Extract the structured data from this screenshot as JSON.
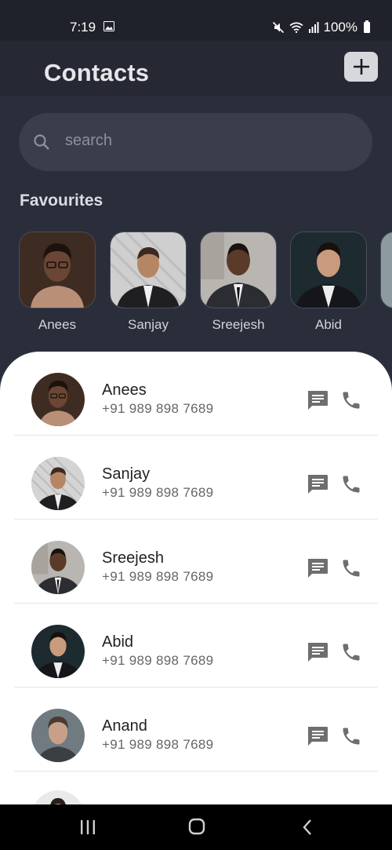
{
  "status_bar": {
    "time": "7:19",
    "battery": "100%",
    "icons": [
      "image-icon",
      "mute-icon",
      "wifi-icon",
      "signal-icon",
      "battery-icon"
    ]
  },
  "header": {
    "title": "Contacts",
    "add_icon": "plus-icon"
  },
  "search": {
    "placeholder": "search",
    "icon": "search-icon"
  },
  "favourites": {
    "title": "Favourites",
    "items": [
      {
        "name": "Anees",
        "bg": "#3e2c22",
        "skin": "#6b4634",
        "shirt": "#b98f78"
      },
      {
        "name": "Sanjay",
        "bg": "#cfcfcf",
        "skin": "#b58664",
        "shirt": "#1f1f22"
      },
      {
        "name": "Sreejesh",
        "bg": "#b9b6b2",
        "skin": "#5a3b2a",
        "shirt": "#2c2d33"
      },
      {
        "name": "Abid",
        "bg": "#1d2a30",
        "skin": "#c99a7c",
        "shirt": "#15161a"
      }
    ]
  },
  "contacts": [
    {
      "name": "Anees",
      "phone": "+91 989 898 7689",
      "bg": "#3e2c22",
      "skin": "#6b4634",
      "shirt": "#b98f78"
    },
    {
      "name": "Sanjay",
      "phone": "+91 989 898 7689",
      "bg": "#d4d4d4",
      "skin": "#b58664",
      "shirt": "#1f1f22"
    },
    {
      "name": "Sreejesh",
      "phone": "+91 989 898 7689",
      "bg": "#b9b6b2",
      "skin": "#5a3b2a",
      "shirt": "#2c2d33"
    },
    {
      "name": "Abid",
      "phone": "+91 989 898 7689",
      "bg": "#1d2a30",
      "skin": "#c99a7c",
      "shirt": "#15161a"
    },
    {
      "name": "Anand",
      "phone": "+91 989 898 7689",
      "bg": "#6f7b80",
      "skin": "#c8a08a",
      "shirt": "#3b3f44"
    }
  ],
  "row_icons": {
    "message": "message-icon",
    "call": "phone-icon"
  },
  "nav": {
    "recents": "recents-icon",
    "home": "home-icon",
    "back": "back-icon"
  },
  "colors": {
    "background": "#2a2d3a",
    "panel": "#ffffff",
    "icon": "#6e6e6e"
  }
}
